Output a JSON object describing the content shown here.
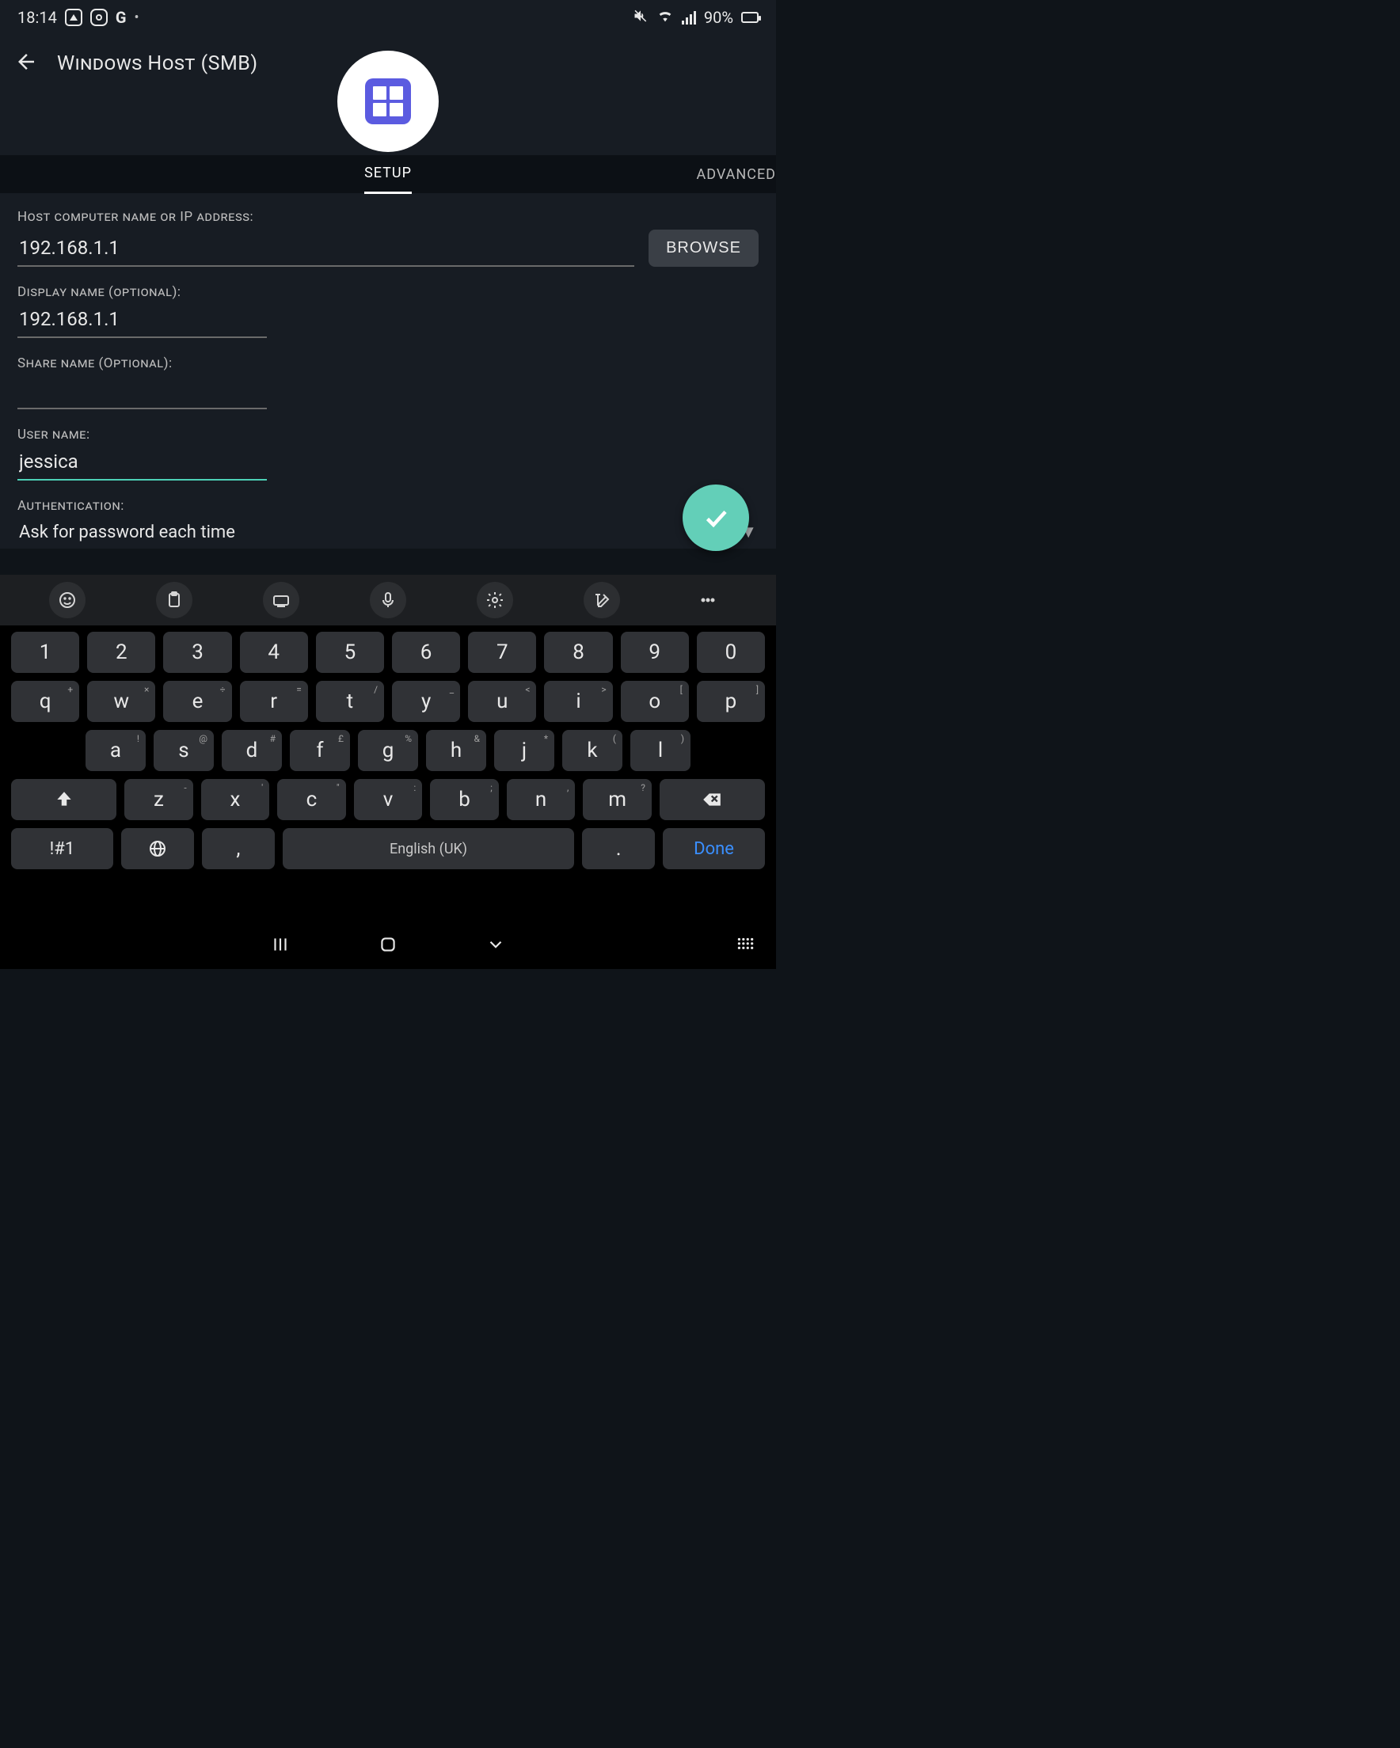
{
  "status": {
    "time": "18:14",
    "battery_pct": "90%"
  },
  "app_title": "Windows Host (SMB)",
  "tabs": {
    "setup": "SETUP",
    "advanced": "ADVANCED"
  },
  "form": {
    "host_label": "Host computer name or IP address:",
    "host_value": "192.168.1.1",
    "browse_label": "BROWSE",
    "display_label": "Display name (optional):",
    "display_value": "192.168.1.1",
    "share_label": "Share name (Optional):",
    "share_value": "",
    "user_label": "User name:",
    "user_value": "jessica",
    "auth_label": "Authentication:",
    "auth_value": "Ask for password each time"
  },
  "keyboard": {
    "row1": [
      "1",
      "2",
      "3",
      "4",
      "5",
      "6",
      "7",
      "8",
      "9",
      "0"
    ],
    "row2": [
      {
        "k": "q",
        "s": "+"
      },
      {
        "k": "w",
        "s": "×"
      },
      {
        "k": "e",
        "s": "÷"
      },
      {
        "k": "r",
        "s": "="
      },
      {
        "k": "t",
        "s": "/"
      },
      {
        "k": "y",
        "s": "_"
      },
      {
        "k": "u",
        "s": "<"
      },
      {
        "k": "i",
        "s": ">"
      },
      {
        "k": "o",
        "s": "["
      },
      {
        "k": "p",
        "s": "]"
      }
    ],
    "row3": [
      {
        "k": "a",
        "s": "!"
      },
      {
        "k": "s",
        "s": "@"
      },
      {
        "k": "d",
        "s": "#"
      },
      {
        "k": "f",
        "s": "£"
      },
      {
        "k": "g",
        "s": "%"
      },
      {
        "k": "h",
        "s": "&"
      },
      {
        "k": "j",
        "s": "*"
      },
      {
        "k": "k",
        "s": "("
      },
      {
        "k": "l",
        "s": ")"
      }
    ],
    "row4": [
      {
        "k": "z",
        "s": "-"
      },
      {
        "k": "x",
        "s": "'"
      },
      {
        "k": "c",
        "s": "\""
      },
      {
        "k": "v",
        "s": ":"
      },
      {
        "k": "b",
        "s": ";"
      },
      {
        "k": "n",
        "s": ","
      },
      {
        "k": "m",
        "s": "?"
      }
    ],
    "sym": "!#1",
    "space_label": "English (UK)",
    "done": "Done",
    "comma": ",",
    "period": "."
  }
}
